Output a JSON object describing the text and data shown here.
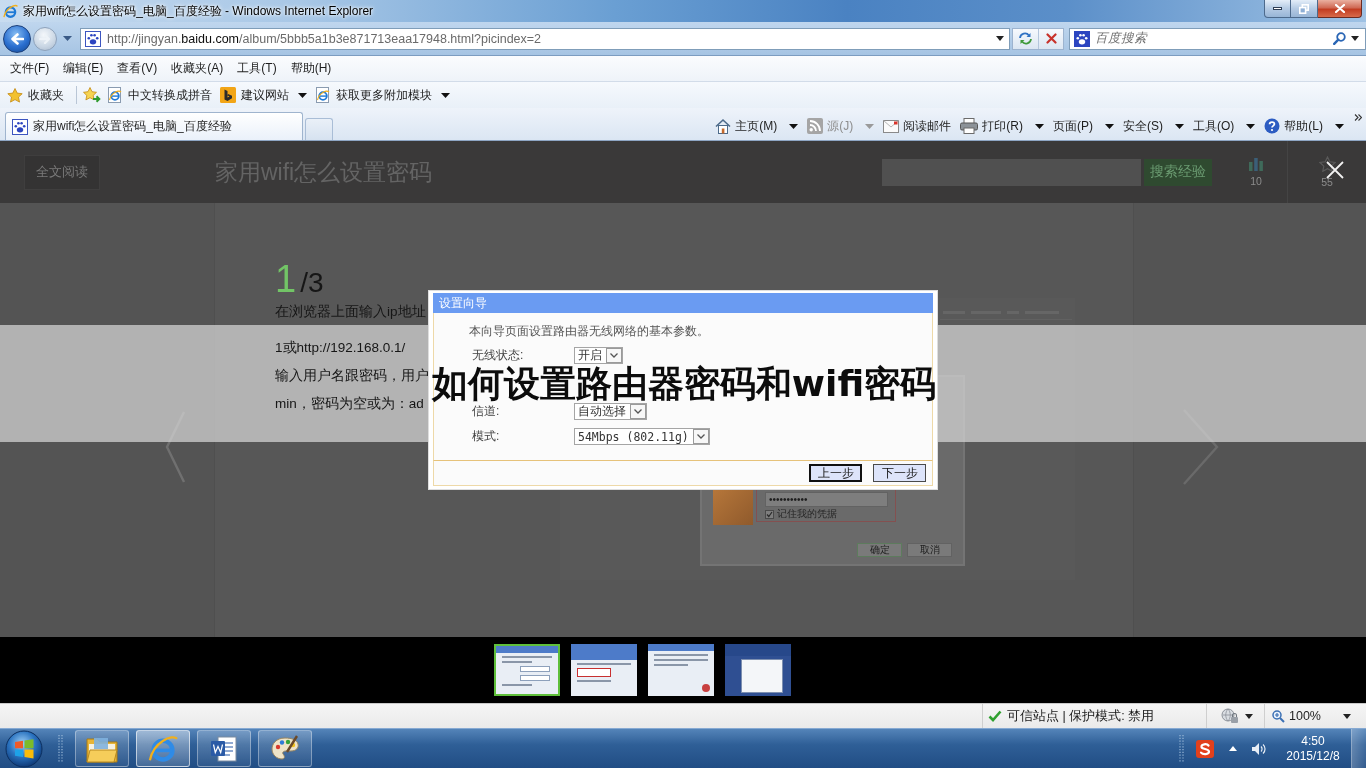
{
  "window": {
    "title": "家用wifi怎么设置密码_电脑_百度经验 - Windows Internet Explorer"
  },
  "address_bar": {
    "url": {
      "prefix": "http://jingyan.",
      "domain": "baidu.com",
      "path": "/album/5bbb5a1b3e871713eaa17948.html?picindex=2"
    }
  },
  "search": {
    "placeholder": "百度搜索"
  },
  "menu": [
    "文件(F)",
    "编辑(E)",
    "查看(V)",
    "收藏夹(A)",
    "工具(T)",
    "帮助(H)"
  ],
  "favorites_bar": {
    "label": "收藏夹",
    "items": [
      {
        "kind": "ie",
        "label": "中文转换成拼音",
        "dropdown": false
      },
      {
        "kind": "bing",
        "label": "建议网站",
        "dropdown": true
      },
      {
        "kind": "ie",
        "label": "获取更多附加模块",
        "dropdown": true
      }
    ]
  },
  "tabs": [
    {
      "label": "家用wifi怎么设置密码_电脑_百度经验",
      "selected": true
    }
  ],
  "command_bar": [
    {
      "kind": "home",
      "label": "主页(M)",
      "dropdown": true,
      "disabled": false
    },
    {
      "kind": "feed",
      "label": "源(J)",
      "dropdown": true,
      "disabled": true
    },
    {
      "kind": "mail",
      "label": "阅读邮件",
      "dropdown": false,
      "disabled": false
    },
    {
      "kind": "print",
      "label": "打印(R)",
      "dropdown": true,
      "disabled": false
    },
    {
      "kind": "plain",
      "label": "页面(P)",
      "dropdown": true,
      "disabled": false
    },
    {
      "kind": "plain",
      "label": "安全(S)",
      "dropdown": true,
      "disabled": false
    },
    {
      "kind": "plain",
      "label": "工具(O)",
      "dropdown": true,
      "disabled": false
    },
    {
      "kind": "help",
      "label": "帮助(L)",
      "dropdown": true,
      "disabled": false
    }
  ],
  "viewer": {
    "read_all": "全文阅读",
    "title": "家用wifi怎么设置密码",
    "search_button": "搜索经验",
    "votes": "10",
    "favorites": "55"
  },
  "article": {
    "step": "1",
    "step_total": "/3",
    "lines": [
      "在浏览器上面输入ip地址",
      "1或http://192.168.0.1/",
      "输入用户名跟密码，用户",
      "min，密码为空或为：ad"
    ],
    "screenshot": {
      "password": "•••••••••••",
      "remember": "记住我的凭据",
      "remember_checked": true,
      "ok": "确定",
      "cancel": "取消"
    }
  },
  "wizard": {
    "title": "设置向导",
    "intro": "本向导页面设置路由器无线网络的基本参数。",
    "fields": [
      {
        "label": "无线状态:",
        "value": "开启"
      },
      {
        "label": "信道:",
        "value": "自动选择"
      },
      {
        "label": "模式:",
        "value": "54Mbps (802.11g)"
      }
    ],
    "buttons": [
      {
        "label": "上一步",
        "focused": true
      },
      {
        "label": "下一步",
        "focused": false
      }
    ]
  },
  "banner": {
    "text": "如何设置路由器密码和wifi密码"
  },
  "thumbnails": [
    {
      "kind": "dialog",
      "selected": true
    },
    {
      "kind": "form",
      "selected": false
    },
    {
      "kind": "notice",
      "selected": false
    },
    {
      "kind": "settings",
      "selected": false
    }
  ],
  "status_bar": {
    "zone": "可信站点 | 保护模式: 禁用",
    "zoom": "100%"
  },
  "taskbar": {
    "apps": [
      {
        "kind": "explorer",
        "active": false
      },
      {
        "kind": "ie",
        "active": true
      },
      {
        "kind": "word",
        "active": false
      },
      {
        "kind": "paint",
        "active": false
      }
    ],
    "time": "4:50",
    "date": "2015/12/8"
  }
}
